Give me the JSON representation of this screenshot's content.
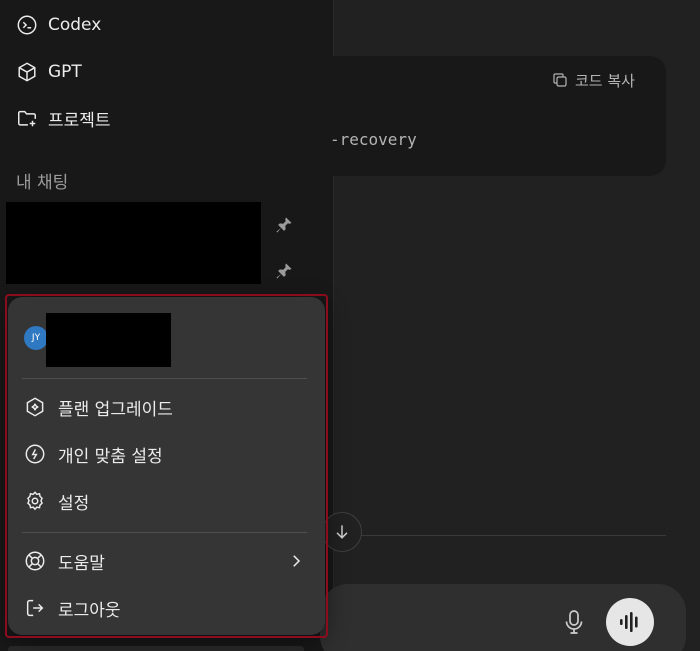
{
  "sidebar": {
    "nav": [
      {
        "label": "Codex",
        "icon": "codex-icon"
      },
      {
        "label": "GPT",
        "icon": "cube-icon"
      },
      {
        "label": "프로젝트",
        "icon": "folder-plus-icon"
      }
    ],
    "section_label": "내 채팅"
  },
  "main": {
    "copy_label": "코드 복사",
    "code_fragment": "-recovery"
  },
  "menu": {
    "avatar_initials": "JY",
    "items": [
      {
        "label": "플랜 업그레이드",
        "icon": "upgrade-sparkle-icon"
      },
      {
        "label": "개인 맞춤 설정",
        "icon": "personalize-icon"
      },
      {
        "label": "설정",
        "icon": "gear-icon"
      },
      {
        "label": "도움말",
        "icon": "lifebuoy-icon"
      },
      {
        "label": "로그아웃",
        "icon": "logout-icon"
      }
    ]
  },
  "colors": {
    "sidebar_bg": "#181818",
    "main_bg": "#212121",
    "menu_bg": "#353535",
    "highlight_border": "#8b0d1d",
    "avatar_bg": "#2f78c2"
  }
}
